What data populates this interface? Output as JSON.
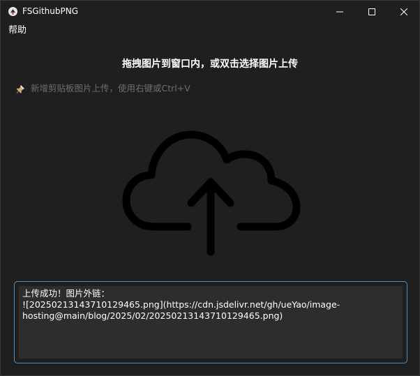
{
  "window": {
    "title": "FSGithubPNG",
    "icons": {
      "app": "app-logo-icon",
      "minimize": "minimize-icon",
      "maximize": "maximize-icon",
      "close": "close-icon"
    }
  },
  "menu": {
    "items": [
      "帮助"
    ]
  },
  "main": {
    "headline": "拖拽图片到窗口内，或双击选择图片上传",
    "hint": "新增剪贴板图片上传，使用右键或Ctrl+V",
    "hint_icon": "pin-icon",
    "drop_icon": "cloud-upload-icon"
  },
  "result": {
    "lines": [
      "上传成功！图片外链：",
      "![20250213143710129465.png](https://cdn.jsdelivr.net/gh/ueYao/image-",
      "hosting@main/blog/2025/02/20250213143710129465.png)"
    ]
  },
  "colors": {
    "background": "#1f1f1f",
    "text": "#ffffff",
    "hint_text": "#6e6e6e",
    "focus_border": "#4a90c4",
    "textarea_bg": "#2d2d2d",
    "icon_stroke": "#000000"
  }
}
